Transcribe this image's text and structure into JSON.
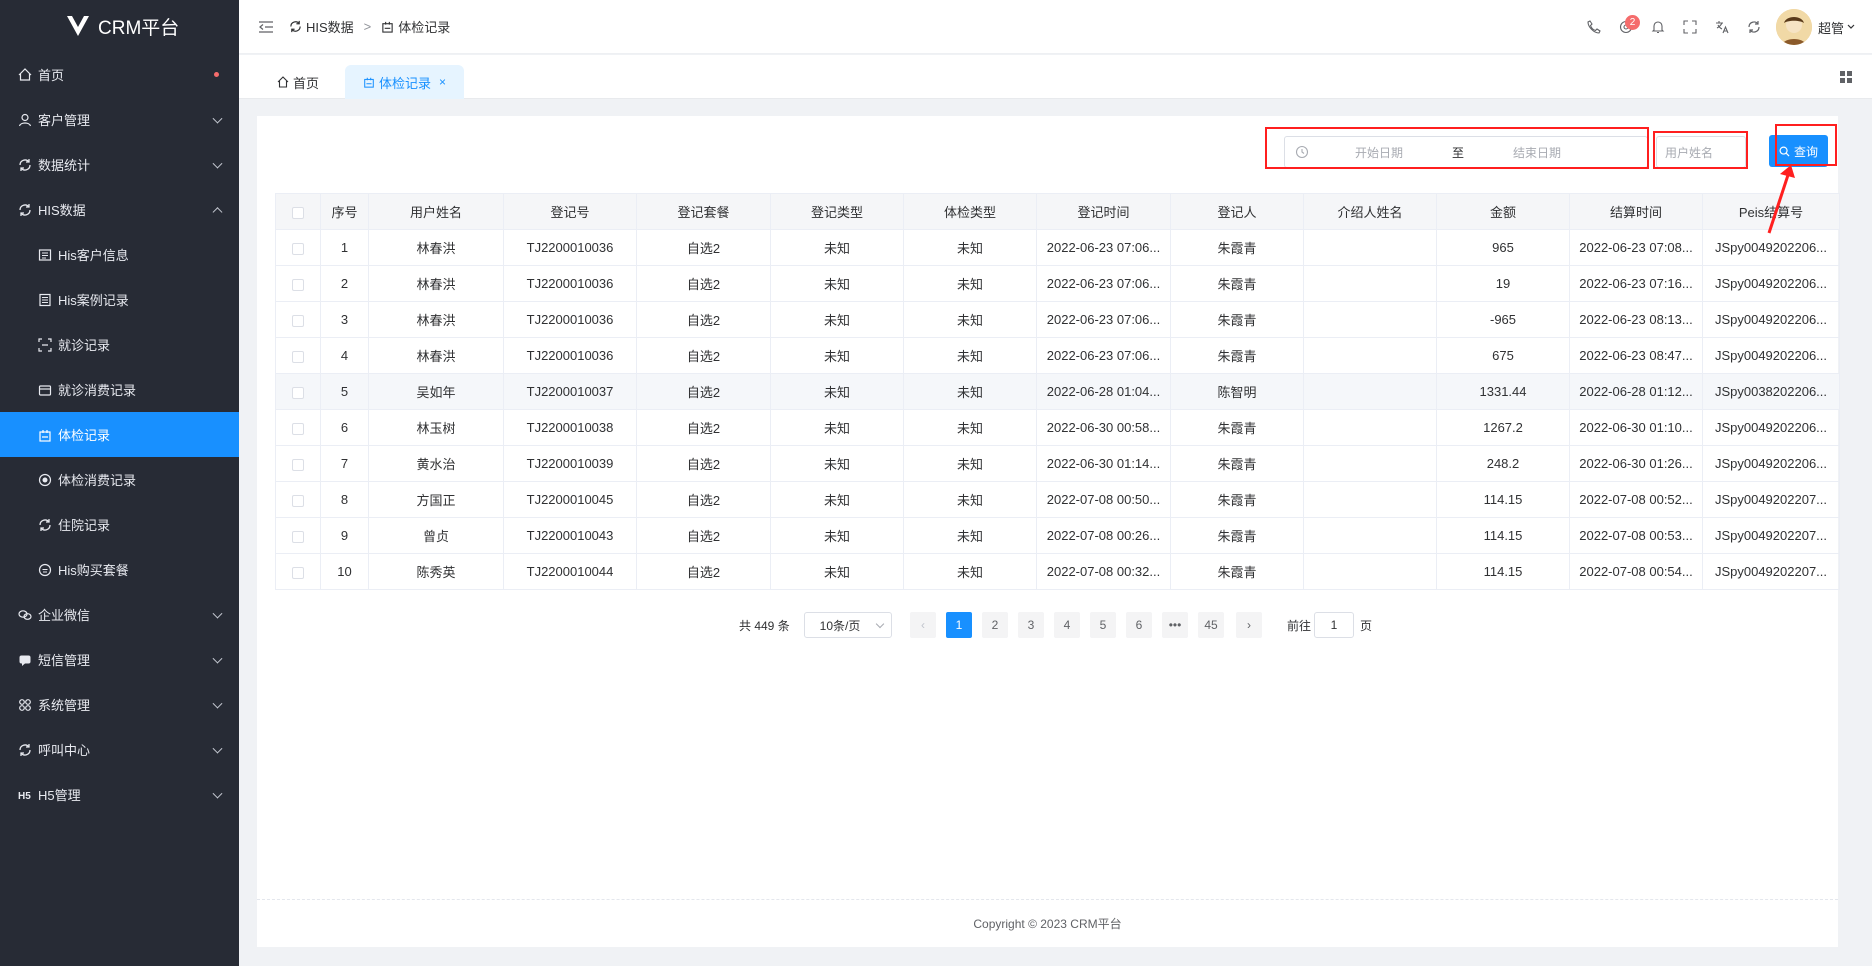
{
  "app": {
    "title": "CRM平台"
  },
  "sidebar": {
    "items": [
      {
        "label": "首页",
        "icon": "home-icon",
        "has_dot": true
      },
      {
        "label": "客户管理",
        "icon": "user-icon"
      },
      {
        "label": "数据统计",
        "icon": "refresh-icon"
      },
      {
        "label": "HIS数据",
        "icon": "refresh-icon",
        "expanded": true
      },
      {
        "label": "His客户信息",
        "icon": "id-card-icon",
        "sub": true
      },
      {
        "label": "His案例记录",
        "icon": "document-icon",
        "sub": true
      },
      {
        "label": "就诊记录",
        "icon": "scan-icon",
        "sub": true
      },
      {
        "label": "就诊消费记录",
        "icon": "wallet-icon",
        "sub": true
      },
      {
        "label": "体检记录",
        "icon": "exam-icon",
        "sub": true,
        "active": true
      },
      {
        "label": "体检消费记录",
        "icon": "coin-icon",
        "sub": true
      },
      {
        "label": "住院记录",
        "icon": "refresh-icon",
        "sub": true
      },
      {
        "label": "His购买套餐",
        "icon": "package-icon",
        "sub": true
      },
      {
        "label": "企业微信",
        "icon": "chat-icon"
      },
      {
        "label": "短信管理",
        "icon": "message-icon"
      },
      {
        "label": "系统管理",
        "icon": "settings-icon"
      },
      {
        "label": "呼叫中心",
        "icon": "refresh-icon"
      },
      {
        "label": "H5管理",
        "icon": "h5-icon"
      }
    ]
  },
  "header": {
    "breadcrumb": [
      "HIS数据",
      "体检记录"
    ],
    "notification_count": "2",
    "user_name": "超管"
  },
  "tabs": [
    {
      "label": "首页"
    },
    {
      "label": "体检记录"
    }
  ],
  "filters": {
    "start_date_placeholder": "开始日期",
    "range_separator": "至",
    "end_date_placeholder": "结束日期",
    "name_placeholder": "用户姓名",
    "query_label": "查询"
  },
  "table": {
    "columns": [
      "序号",
      "用户姓名",
      "登记号",
      "登记套餐",
      "登记类型",
      "体检类型",
      "登记时间",
      "登记人",
      "介绍人姓名",
      "金额",
      "结算时间",
      "Peis结算号"
    ],
    "rows": [
      [
        "1",
        "林春洪",
        "TJ2200010036",
        "自选2",
        "未知",
        "未知",
        "2022-06-23 07:06...",
        "朱霞青",
        "",
        "965",
        "2022-06-23 07:08...",
        "JSpy0049202206..."
      ],
      [
        "2",
        "林春洪",
        "TJ2200010036",
        "自选2",
        "未知",
        "未知",
        "2022-06-23 07:06...",
        "朱霞青",
        "",
        "19",
        "2022-06-23 07:16...",
        "JSpy0049202206..."
      ],
      [
        "3",
        "林春洪",
        "TJ2200010036",
        "自选2",
        "未知",
        "未知",
        "2022-06-23 07:06...",
        "朱霞青",
        "",
        "-965",
        "2022-06-23 08:13...",
        "JSpy0049202206..."
      ],
      [
        "4",
        "林春洪",
        "TJ2200010036",
        "自选2",
        "未知",
        "未知",
        "2022-06-23 07:06...",
        "朱霞青",
        "",
        "675",
        "2022-06-23 08:47...",
        "JSpy0049202206..."
      ],
      [
        "5",
        "吴如年",
        "TJ2200010037",
        "自选2",
        "未知",
        "未知",
        "2022-06-28 01:04...",
        "陈智明",
        "",
        "1331.44",
        "2022-06-28 01:12...",
        "JSpy0038202206..."
      ],
      [
        "6",
        "林玉树",
        "TJ2200010038",
        "自选2",
        "未知",
        "未知",
        "2022-06-30 00:58...",
        "朱霞青",
        "",
        "1267.2",
        "2022-06-30 01:10...",
        "JSpy0049202206..."
      ],
      [
        "7",
        "黄水治",
        "TJ2200010039",
        "自选2",
        "未知",
        "未知",
        "2022-06-30 01:14...",
        "朱霞青",
        "",
        "248.2",
        "2022-06-30 01:26...",
        "JSpy0049202206..."
      ],
      [
        "8",
        "方国正",
        "TJ2200010045",
        "自选2",
        "未知",
        "未知",
        "2022-07-08 00:50...",
        "朱霞青",
        "",
        "114.15",
        "2022-07-08 00:52...",
        "JSpy0049202207..."
      ],
      [
        "9",
        "曾贞",
        "TJ2200010043",
        "自选2",
        "未知",
        "未知",
        "2022-07-08 00:26...",
        "朱霞青",
        "",
        "114.15",
        "2022-07-08 00:53...",
        "JSpy0049202207..."
      ],
      [
        "10",
        "陈秀英",
        "TJ2200010044",
        "自选2",
        "未知",
        "未知",
        "2022-07-08 00:32...",
        "朱霞青",
        "",
        "114.15",
        "2022-07-08 00:54...",
        "JSpy0049202207..."
      ]
    ]
  },
  "pagination": {
    "total": "共 449 条",
    "page_size": "10条/页",
    "pages": [
      "1",
      "2",
      "3",
      "4",
      "5",
      "6",
      "•••",
      "45"
    ],
    "current": "1",
    "goto_prefix": "前往",
    "goto_value": "1",
    "goto_suffix": "页"
  },
  "footer": {
    "copyright": "Copyright © 2023 CRM平台"
  },
  "colors": {
    "accent": "#1890ff",
    "sidebar_bg": "#272b35",
    "highlight": "#ff1f1f"
  }
}
